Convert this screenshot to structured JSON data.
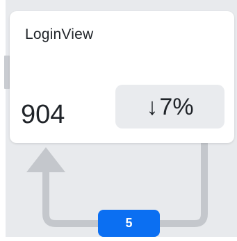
{
  "node": {
    "title": "LoginView",
    "value": "904",
    "trend": {
      "direction": "down",
      "arrow": "↓",
      "percent": "7%"
    }
  },
  "connector": {
    "count": "5"
  },
  "icons": {
    "trend_icon": "arrow-down-icon",
    "connector_arrow": "arrow-up-icon"
  },
  "colors": {
    "badge": "#0b6ff2",
    "connector": "#c4c7cc",
    "background": "#e8eaed",
    "card": "#ffffff",
    "pill": "#e9ebee"
  }
}
